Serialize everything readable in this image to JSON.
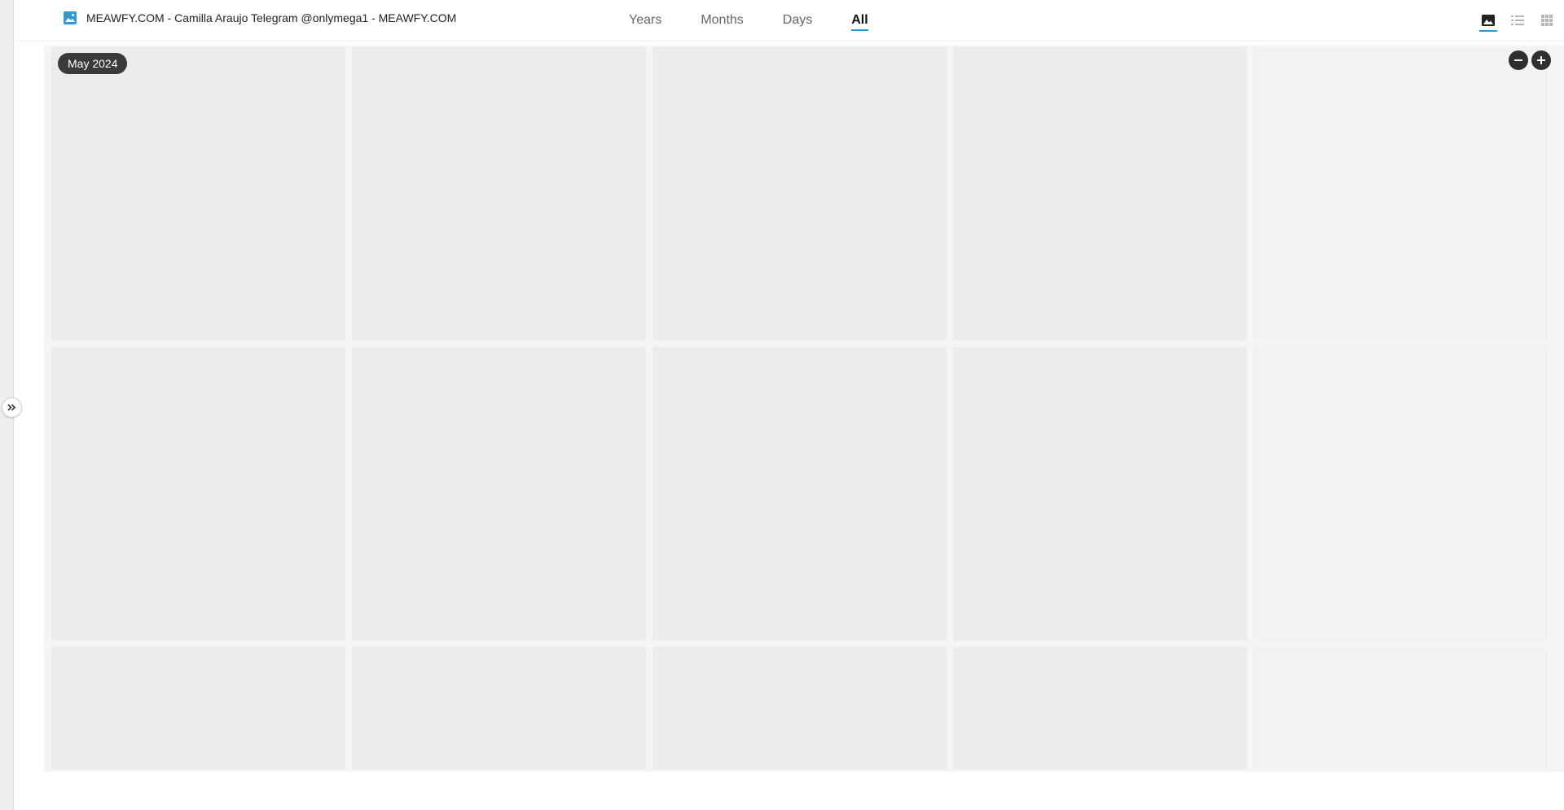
{
  "header": {
    "title": "MEAWFY.COM - Camilla Araujo Telegram @onlymega1 - MEAWFY.COM",
    "tabs": [
      {
        "label": "Years",
        "active": false
      },
      {
        "label": "Months",
        "active": false
      },
      {
        "label": "Days",
        "active": false
      },
      {
        "label": "All",
        "active": true
      }
    ],
    "view_modes": [
      "thumbnail-view-icon",
      "list-view-icon",
      "grid-view-icon"
    ]
  },
  "gallery": {
    "date_label": "May 2024",
    "zoom_out_icon": "minus-circle-icon",
    "zoom_in_icon": "plus-circle-icon"
  },
  "colors": {
    "accent": "#2e9ad0",
    "tile_placeholder": "#ececec",
    "badge_bg": "#3a3a3a"
  }
}
